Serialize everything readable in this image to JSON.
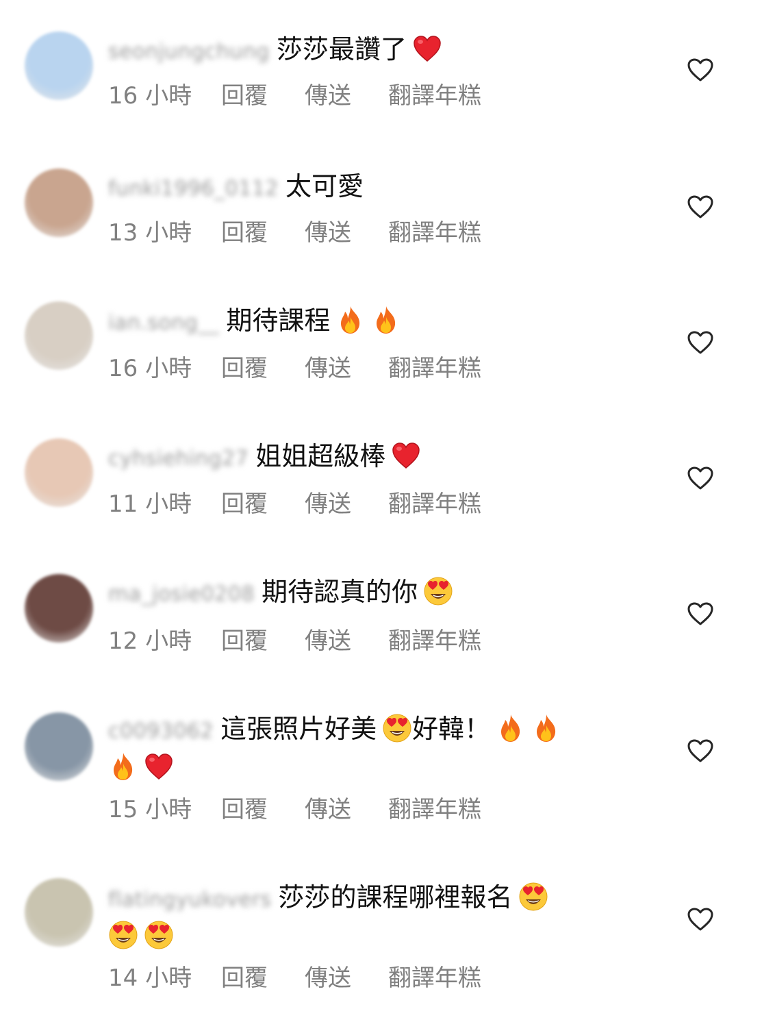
{
  "comments": [
    {
      "username": "seonjungchung",
      "text": "莎莎最讚了",
      "emojis_after": [
        "heart"
      ],
      "emoji_line2": [],
      "time": "16 小時",
      "reply": "回覆",
      "send": "傳送",
      "translate": "翻譯年糕",
      "avatar_color": "#b9d4ef"
    },
    {
      "username": "funki1996_0112",
      "text": "太可愛",
      "emojis_after": [],
      "emoji_line2": [],
      "time": "13 小時",
      "reply": "回覆",
      "send": "傳送",
      "translate": "翻譯年糕",
      "avatar_color": "#c9a58f"
    },
    {
      "username": "ian.song__",
      "text": "期待課程",
      "emojis_after": [
        "fire",
        "fire"
      ],
      "emoji_line2": [],
      "time": "16 小時",
      "reply": "回覆",
      "send": "傳送",
      "translate": "翻譯年糕",
      "avatar_color": "#d8cfc4"
    },
    {
      "username": "cyhsiehing27",
      "text": "姐姐超級棒",
      "emojis_after": [
        "heart"
      ],
      "emoji_line2": [],
      "time": "11 小時",
      "reply": "回覆",
      "send": "傳送",
      "translate": "翻譯年糕",
      "avatar_color": "#e7c8b5"
    },
    {
      "username": "ma_josie0208",
      "text": "期待認真的你",
      "emojis_after": [
        "heart-eyes"
      ],
      "emoji_line2": [],
      "time": "12 小時",
      "reply": "回覆",
      "send": "傳送",
      "translate": "翻譯年糕",
      "avatar_color": "#6e4b45"
    },
    {
      "username": "c0093062",
      "text": "這張照片好美",
      "text2": "好韓！",
      "emojis_after": [
        "heart-eyes"
      ],
      "emojis_after2": [
        "fire",
        "fire"
      ],
      "emoji_line2": [
        "fire",
        "heart"
      ],
      "time": "15 小時",
      "reply": "回覆",
      "send": "傳送",
      "translate": "翻譯年糕",
      "avatar_color": "#8796a6"
    },
    {
      "username": "flatingyukovers",
      "text": "莎莎的課程哪裡報名",
      "emojis_after": [
        "heart-eyes"
      ],
      "emoji_line2": [
        "heart-eyes",
        "heart-eyes"
      ],
      "time": "14 小時",
      "reply": "回覆",
      "send": "傳送",
      "translate": "翻譯年糕",
      "avatar_color": "#c9c4b0"
    }
  ],
  "like_icon": "heart-outline-icon"
}
